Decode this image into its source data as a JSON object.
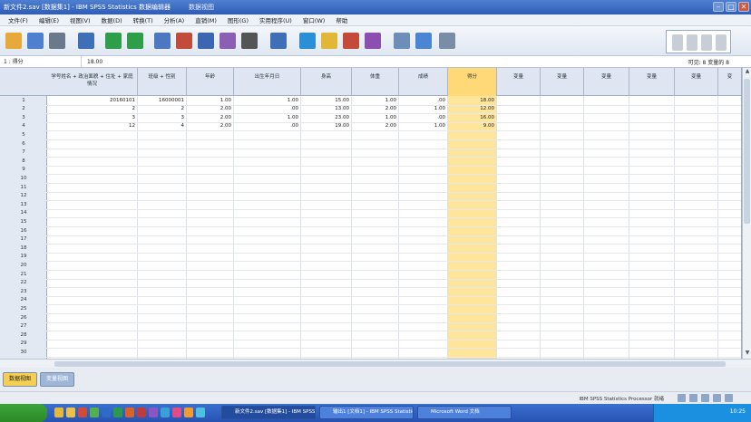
{
  "window": {
    "app_title": "新文件2.sav [数据集1] - IBM SPSS Statistics 数据编辑器",
    "doc_title": "数据视图",
    "controls": {
      "minimize": "–",
      "maximize": "□",
      "close": "✕"
    }
  },
  "menu": {
    "items": [
      "文件(F)",
      "编辑(E)",
      "视图(V)",
      "数据(D)",
      "转换(T)",
      "分析(A)",
      "直销(M)",
      "图形(G)",
      "实用程序(U)",
      "窗口(W)",
      "帮助"
    ]
  },
  "toolbar": {
    "icons": [
      "open-icon",
      "save-icon",
      "print-icon",
      "dialog-recall-icon",
      "undo-icon",
      "redo-icon",
      "goto-case-icon",
      "goto-variable-icon",
      "variables-icon",
      "run-descriptives-icon",
      "find-icon",
      "insert-cases-icon",
      "insert-variable-icon",
      "split-file-icon",
      "weight-cases-icon",
      "select-cases-icon",
      "value-labels-icon",
      "use-sets-icon",
      "spell-icon"
    ],
    "colors": [
      "#e7a93a",
      "#4f7fcf",
      "#6a7a8c",
      "#3f6fb6",
      "#2e9e4b",
      "#2e9e4b",
      "#4c78c1",
      "#c24c3c",
      "#3b66b2",
      "#8b5fb3",
      "#555555",
      "#3f6fb6",
      "#2a8fd6",
      "#e2b637",
      "#c44a3a",
      "#8b4fb0",
      "#6c8eb8",
      "#4b86d4",
      "#7a8da6"
    ]
  },
  "cellbar": {
    "cell_ref": "1 : 得分",
    "cell_value": "18.00",
    "visible_text": "可见: 8 变量的 8"
  },
  "grid": {
    "columns": [
      {
        "header": "学号姓名 + 政治面貌 + 住址 + 家庭情况",
        "selected": false
      },
      {
        "header": "班级 + 性别",
        "selected": false
      },
      {
        "header": "年龄",
        "selected": false
      },
      {
        "header": "出生年月日",
        "selected": false
      },
      {
        "header": "身高",
        "selected": false
      },
      {
        "header": "体重",
        "selected": false
      },
      {
        "header": "成绩",
        "selected": false
      },
      {
        "header": "得分",
        "selected": true
      },
      {
        "header": "变量",
        "selected": false
      },
      {
        "header": "变量",
        "selected": false
      },
      {
        "header": "变量",
        "selected": false
      },
      {
        "header": "变量",
        "selected": false
      },
      {
        "header": "变量",
        "selected": false
      },
      {
        "header": "变",
        "selected": false
      }
    ],
    "row_numbers": [
      "1",
      "2",
      "3",
      "4",
      "5",
      "6",
      "7",
      "8",
      "9",
      "10",
      "11",
      "12",
      "13",
      "14",
      "15",
      "16",
      "17",
      "18",
      "19",
      "20",
      "21",
      "22",
      "23",
      "24",
      "25",
      "26",
      "27",
      "28",
      "29",
      "30"
    ],
    "rows": [
      [
        "20160101",
        "16000001",
        "1.00",
        "1.00",
        "15.00",
        "1.00",
        ".00",
        "18.00"
      ],
      [
        "2",
        "2",
        "2.00",
        ".00",
        "13.00",
        "2.00",
        "1.00",
        "12.00"
      ],
      [
        "3",
        "3",
        "2.00",
        "1.00",
        "23.00",
        "1.00",
        ".00",
        "16.00"
      ],
      [
        "12",
        "4",
        "2.00",
        ".00",
        "19.00",
        "2.00",
        "1.00",
        "9.00"
      ]
    ]
  },
  "tabs": {
    "data_view": "数据视图",
    "variable_view": "变量视图"
  },
  "statusbar": {
    "text": "IBM SPSS Statistics Processor 就绪",
    "icons": [
      "ime-icon",
      "help-icon",
      "lang-icon",
      "keyboard-icon",
      "settings-icon"
    ]
  },
  "taskbar": {
    "quicklaunch": [
      "ie-icon",
      "folder-icon",
      "media-icon",
      "chat-icon",
      "word-icon",
      "excel-icon",
      "ppt-icon",
      "spss-icon",
      "music-icon",
      "paint-icon",
      "player-icon",
      "browser-icon",
      "mail-icon"
    ],
    "quicklaunch_colors": [
      "#e7b93a",
      "#f0c044",
      "#d14a3c",
      "#54b04a",
      "#2f6ac8",
      "#2c9a4c",
      "#d9622b",
      "#c43a3a",
      "#8c55c4",
      "#3aa0d8",
      "#e04c8a",
      "#f39a2b",
      "#4ec0e0"
    ],
    "tasks": [
      {
        "label": "新文件2.sav [数据集1] - IBM SPSS",
        "active": true
      },
      {
        "label": "输出1 [文档1] - IBM SPSS Statistics",
        "active": false
      },
      {
        "label": "Microsoft Word 文档",
        "active": false
      }
    ],
    "clock": "10:25"
  }
}
